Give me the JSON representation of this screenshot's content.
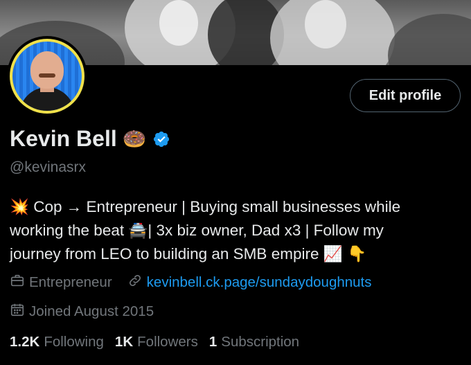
{
  "profile": {
    "name": "Kevin Bell",
    "name_emoji": "🍩",
    "handle": "@kevinasrx",
    "verified": true,
    "edit_button": "Edit profile",
    "bio_lines": [
      "💥 Cop → Entrepreneur | Buying small businesses while",
      "working the beat 🚔| 3x biz owner, Dad x3 | Follow my",
      "journey from LEO to building an SMB empire 📈 👇"
    ],
    "profession": "Entrepreneur",
    "website": "kevinbell.ck.page/sundaydoughnuts",
    "joined": "Joined August 2015"
  },
  "stats": {
    "following_count": "1.2K",
    "following_label": "Following",
    "followers_count": "1K",
    "followers_label": "Followers",
    "subscriptions_count": "1",
    "subscriptions_label": "Subscription"
  },
  "icons": {
    "verified": "verified-badge-icon",
    "profession": "briefcase-icon",
    "website": "link-icon",
    "joined": "calendar-icon"
  },
  "colors": {
    "background": "#000000",
    "primary_text": "#e7e9ea",
    "secondary_text": "#71767b",
    "link": "#1d9bf0",
    "verified": "#1d9bf0",
    "avatar_ring": "#f0e14a"
  }
}
